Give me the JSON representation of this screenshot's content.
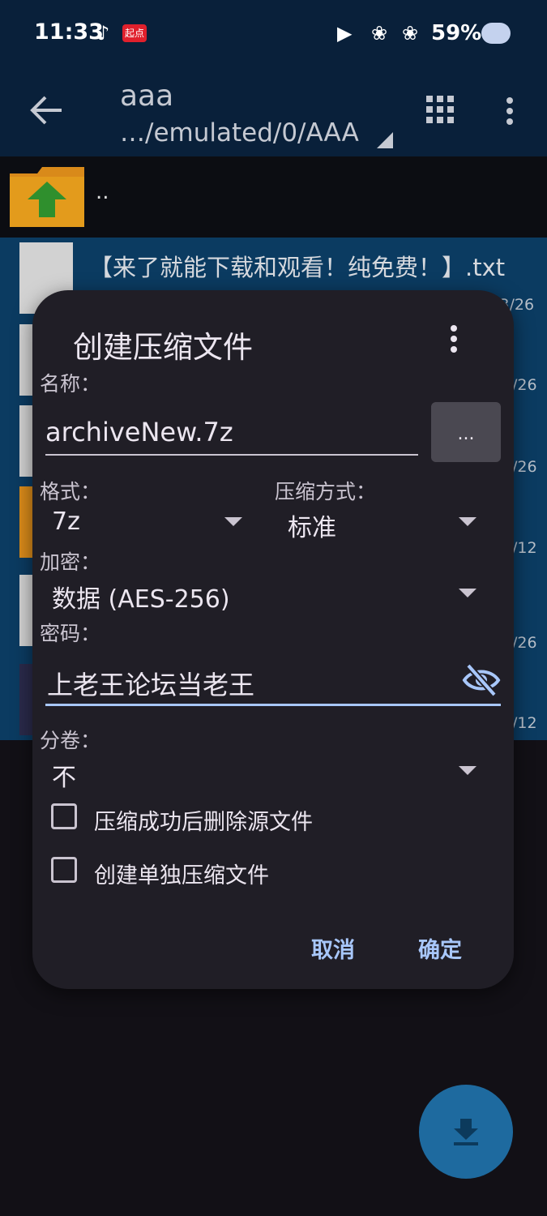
{
  "status_bar": {
    "time": "11:33",
    "app_badge": "起点",
    "battery": "59%"
  },
  "app_bar": {
    "title": "aaa",
    "path": "…/emulated/0/AAA"
  },
  "file_list": {
    "parent_label": "..",
    "files": [
      {
        "name": "【来了就能下载和观看！纯免费！】.txt",
        "date": "/3/26"
      },
      {
        "name": "",
        "date": "/26"
      },
      {
        "name": "",
        "date": "/26"
      },
      {
        "name": "",
        "date": "/12"
      },
      {
        "name": "",
        "date": "/26"
      },
      {
        "name": "",
        "date": "/12"
      }
    ]
  },
  "dialog": {
    "title": "创建压缩文件",
    "name_label": "名称：",
    "name_value": "archiveNew.7z",
    "browse_label": "...",
    "format_label": "格式：",
    "format_value": "7z",
    "method_label": "压缩方式：",
    "method_value": "标准",
    "encryption_label": "加密：",
    "encryption_value": "数据 (AES-256)",
    "password_label": "密码：",
    "password_value": "上老王论坛当老王",
    "split_label": "分卷：",
    "split_value": "不",
    "checkbox_delete": "压缩成功后删除源文件",
    "checkbox_separate": "创建单独压缩文件",
    "cancel": "取消",
    "ok": "确定"
  },
  "colors": {
    "accent": "#a8c7fa",
    "dialog_bg": "#201e26",
    "appbar_bg": "#09203a",
    "list_bg": "#0b3b61"
  }
}
